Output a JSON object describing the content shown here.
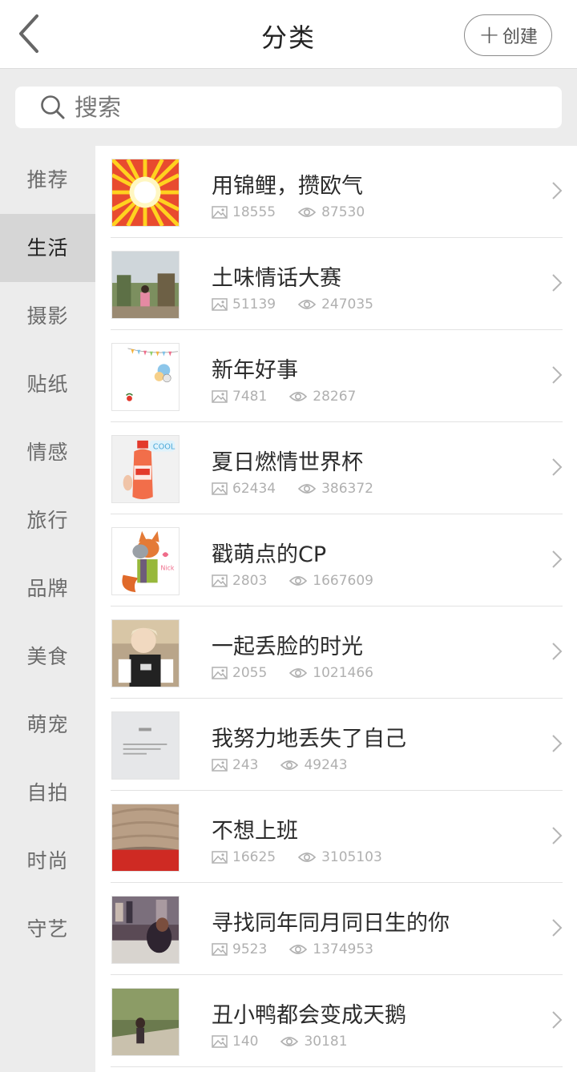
{
  "header": {
    "title": "分类",
    "create_label": "创建"
  },
  "search": {
    "placeholder": "搜索"
  },
  "sidebar": {
    "items": [
      {
        "label": "推荐"
      },
      {
        "label": "生活"
      },
      {
        "label": "摄影"
      },
      {
        "label": "贴纸"
      },
      {
        "label": "情感"
      },
      {
        "label": "旅行"
      },
      {
        "label": "品牌"
      },
      {
        "label": "美食"
      },
      {
        "label": "萌宠"
      },
      {
        "label": "自拍"
      },
      {
        "label": "时尚"
      },
      {
        "label": "守艺"
      }
    ],
    "active": "生活"
  },
  "list": {
    "items": [
      {
        "title": "用锦鲤，攒欧气",
        "images": "18555",
        "views": "87530"
      },
      {
        "title": "土味情话大赛",
        "images": "51139",
        "views": "247035"
      },
      {
        "title": "新年好事",
        "images": "7481",
        "views": "28267"
      },
      {
        "title": "夏日燃情世界杯",
        "images": "62434",
        "views": "386372"
      },
      {
        "title": "戳萌点的CP",
        "images": "2803",
        "views": "1667609"
      },
      {
        "title": "一起丢脸的时光",
        "images": "2055",
        "views": "1021466"
      },
      {
        "title": "我努力地丢失了自己",
        "images": "243",
        "views": "49243"
      },
      {
        "title": "不想上班",
        "images": "16625",
        "views": "3105103"
      },
      {
        "title": "寻找同年同月同日生的你",
        "images": "9523",
        "views": "1374953"
      },
      {
        "title": "丑小鸭都会变成天鹅",
        "images": "140",
        "views": "30181"
      }
    ]
  },
  "icons": {
    "back": "chevron-left-icon",
    "search": "search-icon",
    "plus": "plus-icon",
    "images": "image-icon",
    "views": "eye-icon",
    "row_arrow": "chevron-right-icon"
  },
  "colors": {
    "active_bg": "#d6d6d6",
    "page_bg": "#ececec",
    "stat_gray": "#b0b0b0"
  }
}
